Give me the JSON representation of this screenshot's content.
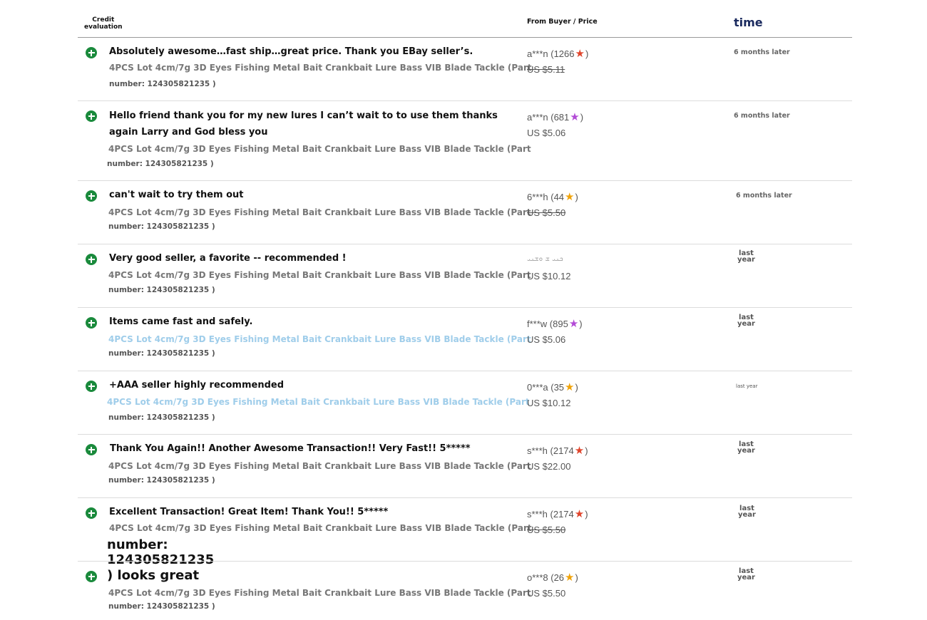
{
  "header": {
    "credit_line1": "Credit",
    "credit_line2": "evaluation",
    "from_buyer_price": "From Buyer / Price",
    "time": "time"
  },
  "rows": [
    {
      "comment": "Absolutely awesome…fast ship…great price. Thank you EBay seller’s.",
      "item": "4PCS Lot 4cm/7g 3D Eyes Fishing Metal Bait Crankbait Lure Bass VIB Blade Tackle (Part",
      "part": "number: 124305821235 )",
      "buyer_prefix": "a***n (1266",
      "buyer_suffix": ")",
      "star_color": "red",
      "price": "US $5.11",
      "price_struck": true,
      "time": "6 months later"
    },
    {
      "comment": "Hello friend thank you for my new lures I can’t wait to to use them thanks again Larry and God bless you",
      "item": "4PCS Lot 4cm/7g 3D Eyes Fishing Metal Bait Crankbait Lure Bass VIB Blade Tackle (Part",
      "part": "number: 124305821235 )",
      "buyer_prefix": "a***n (681",
      "buyer_suffix": ")",
      "star_color": "purple",
      "price": "US $5.06",
      "price_struck": false,
      "time": "6 months later"
    },
    {
      "comment": "can't wait to try them out",
      "item": "4PCS Lot 4cm/7g 3D Eyes Fishing Metal Bait Crankbait Lure Bass VIB Blade Tackle (Part",
      "part": "number: 124305821235 )",
      "buyer_prefix": "6***h (44",
      "buyer_suffix": ")",
      "star_color": "gold",
      "price": "US $5.50",
      "price_struck": true,
      "time": "6 months later"
    },
    {
      "comment": "Very good seller, a favorite -- recommended !",
      "item": "4PCS Lot 4cm/7g 3D Eyes Fishing Metal Bait Crankbait Lure Bass VIB Blade Tackle (Part",
      "part": "number: 124305821235 )",
      "buyer_garbled": "ܟܢܝ ܫ ܘܫܢܝ",
      "price": "US $10.12",
      "price_struck": false,
      "time_line1": "last",
      "time_line2": "year"
    },
    {
      "comment": "Items came fast and safely.",
      "item": "4PCS Lot 4cm/7g 3D Eyes Fishing Metal Bait Crankbait Lure Bass VIB Blade Tackle (Part",
      "part": "number: 124305821235 )",
      "buyer_prefix": "f***w (895",
      "buyer_suffix": ")",
      "star_color": "purple",
      "price": "US $5.06",
      "price_struck": false,
      "time_line1": "last",
      "time_line2": "year"
    },
    {
      "comment": "+AAA seller highly recommended",
      "item": "4PCS Lot 4cm/7g 3D Eyes Fishing Metal Bait Crankbait Lure Bass VIB Blade Tackle (Part",
      "part": "number: 124305821235 )",
      "buyer_prefix": "0***a (35",
      "buyer_suffix": ")",
      "star_color": "gold",
      "price": "US $10.12",
      "price_struck": false,
      "time": "last year"
    },
    {
      "comment": "Thank You Again!! Another Awesome Transaction!! Very Fast!! 5*****",
      "item": "4PCS Lot 4cm/7g 3D Eyes Fishing Metal Bait Crankbait Lure Bass VIB Blade Tackle (Part",
      "part": "number: 124305821235 )",
      "buyer_prefix": "s***h (2174",
      "buyer_suffix": ")",
      "star_color": "red",
      "price": "US $22.00",
      "price_struck": false,
      "time_line1": "last",
      "time_line2": "year"
    },
    {
      "comment": "Excellent Transaction! Great Item! Thank You!! 5*****",
      "item": "4PCS Lot 4cm/7g 3D Eyes Fishing Metal Bait Crankbait Lure Bass VIB Blade Tackle (Part",
      "part_line1": "number:",
      "part_line2": "124305821235",
      "buyer_prefix": "s***h (2174",
      "buyer_suffix": ")",
      "star_color": "red",
      "price": "US $5.50",
      "price_struck": true,
      "time_line1": "last",
      "time_line2": "year"
    },
    {
      "comment": ") looks great",
      "item": "4PCS Lot 4cm/7g 3D Eyes Fishing Metal Bait Crankbait Lure Bass VIB Blade Tackle (Part",
      "part": "number: 124305821235 )",
      "buyer_prefix": "o***8 (26",
      "buyer_suffix": ")",
      "star_color": "gold",
      "price": "US $5.50",
      "price_struck": false,
      "time_line1": "last",
      "time_line2": "year"
    }
  ],
  "star_glyph": "★"
}
